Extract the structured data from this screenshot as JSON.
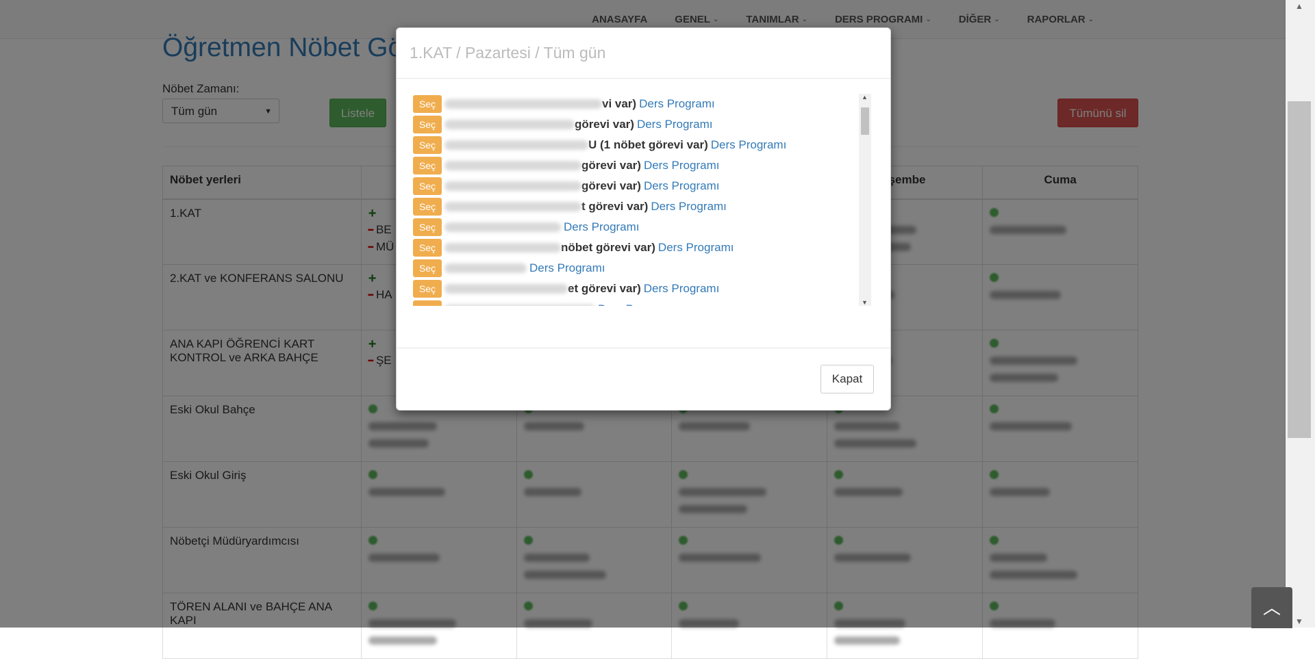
{
  "nav": {
    "items": [
      {
        "label": "ANASAYFA",
        "caret": false
      },
      {
        "label": "GENEL",
        "caret": true
      },
      {
        "label": "TANIMLAR",
        "caret": true
      },
      {
        "label": "DERS PROGRAMI",
        "caret": true
      },
      {
        "label": "DİĞER",
        "caret": true
      },
      {
        "label": "RAPORLAR",
        "caret": true
      }
    ]
  },
  "page": {
    "title": "Öğretmen Nöbet Görev",
    "time_label": "Nöbet Zamanı:",
    "time_value": "Tüm gün",
    "list_button": "Listele",
    "delete_all_button": "Tümünü sil"
  },
  "table": {
    "headers": [
      "Nöbet yerleri",
      "",
      "",
      "",
      "rşembe",
      "Cuma"
    ],
    "rows": [
      {
        "place": "1.KAT",
        "visible_names": [
          "BE",
          "MÜ"
        ]
      },
      {
        "place": "2.KAT ve KONFERANS SALONU",
        "visible_names": [
          "HA"
        ]
      },
      {
        "place": "ANA KAPI ÖĞRENCİ KART KONTROL ve ARKA BAHÇE",
        "visible_names": [
          "ŞE"
        ]
      },
      {
        "place": "Eski Okul Bahçe",
        "visible_names": []
      },
      {
        "place": "Eski Okul Giriş",
        "visible_names": []
      },
      {
        "place": "Nöbetçi Müdüryardımcısı",
        "visible_names": []
      },
      {
        "place": "TÖREN ALANI ve BAHÇE ANA KAPI",
        "visible_names": []
      }
    ]
  },
  "modal": {
    "title": "1.KAT / Pazartesi / Tüm gün",
    "select_label": "Seç",
    "link_label": "Ders Programı",
    "items": [
      {
        "visible": "vi var)",
        "bold": true
      },
      {
        "visible": "görevi var)",
        "bold": true
      },
      {
        "visible": "U (1 nöbet görevi var)",
        "bold": true
      },
      {
        "visible": "görevi var)",
        "bold": true
      },
      {
        "visible": "görevi var)",
        "bold": true
      },
      {
        "visible": "t görevi var)",
        "bold": true
      },
      {
        "visible": "",
        "bold": false
      },
      {
        "visible": "nöbet görevi var)",
        "bold": true
      },
      {
        "visible": "",
        "bold": false
      },
      {
        "visible": "et görevi var)",
        "bold": true
      },
      {
        "visible": "",
        "bold": false
      }
    ],
    "close_button": "Kapat"
  }
}
